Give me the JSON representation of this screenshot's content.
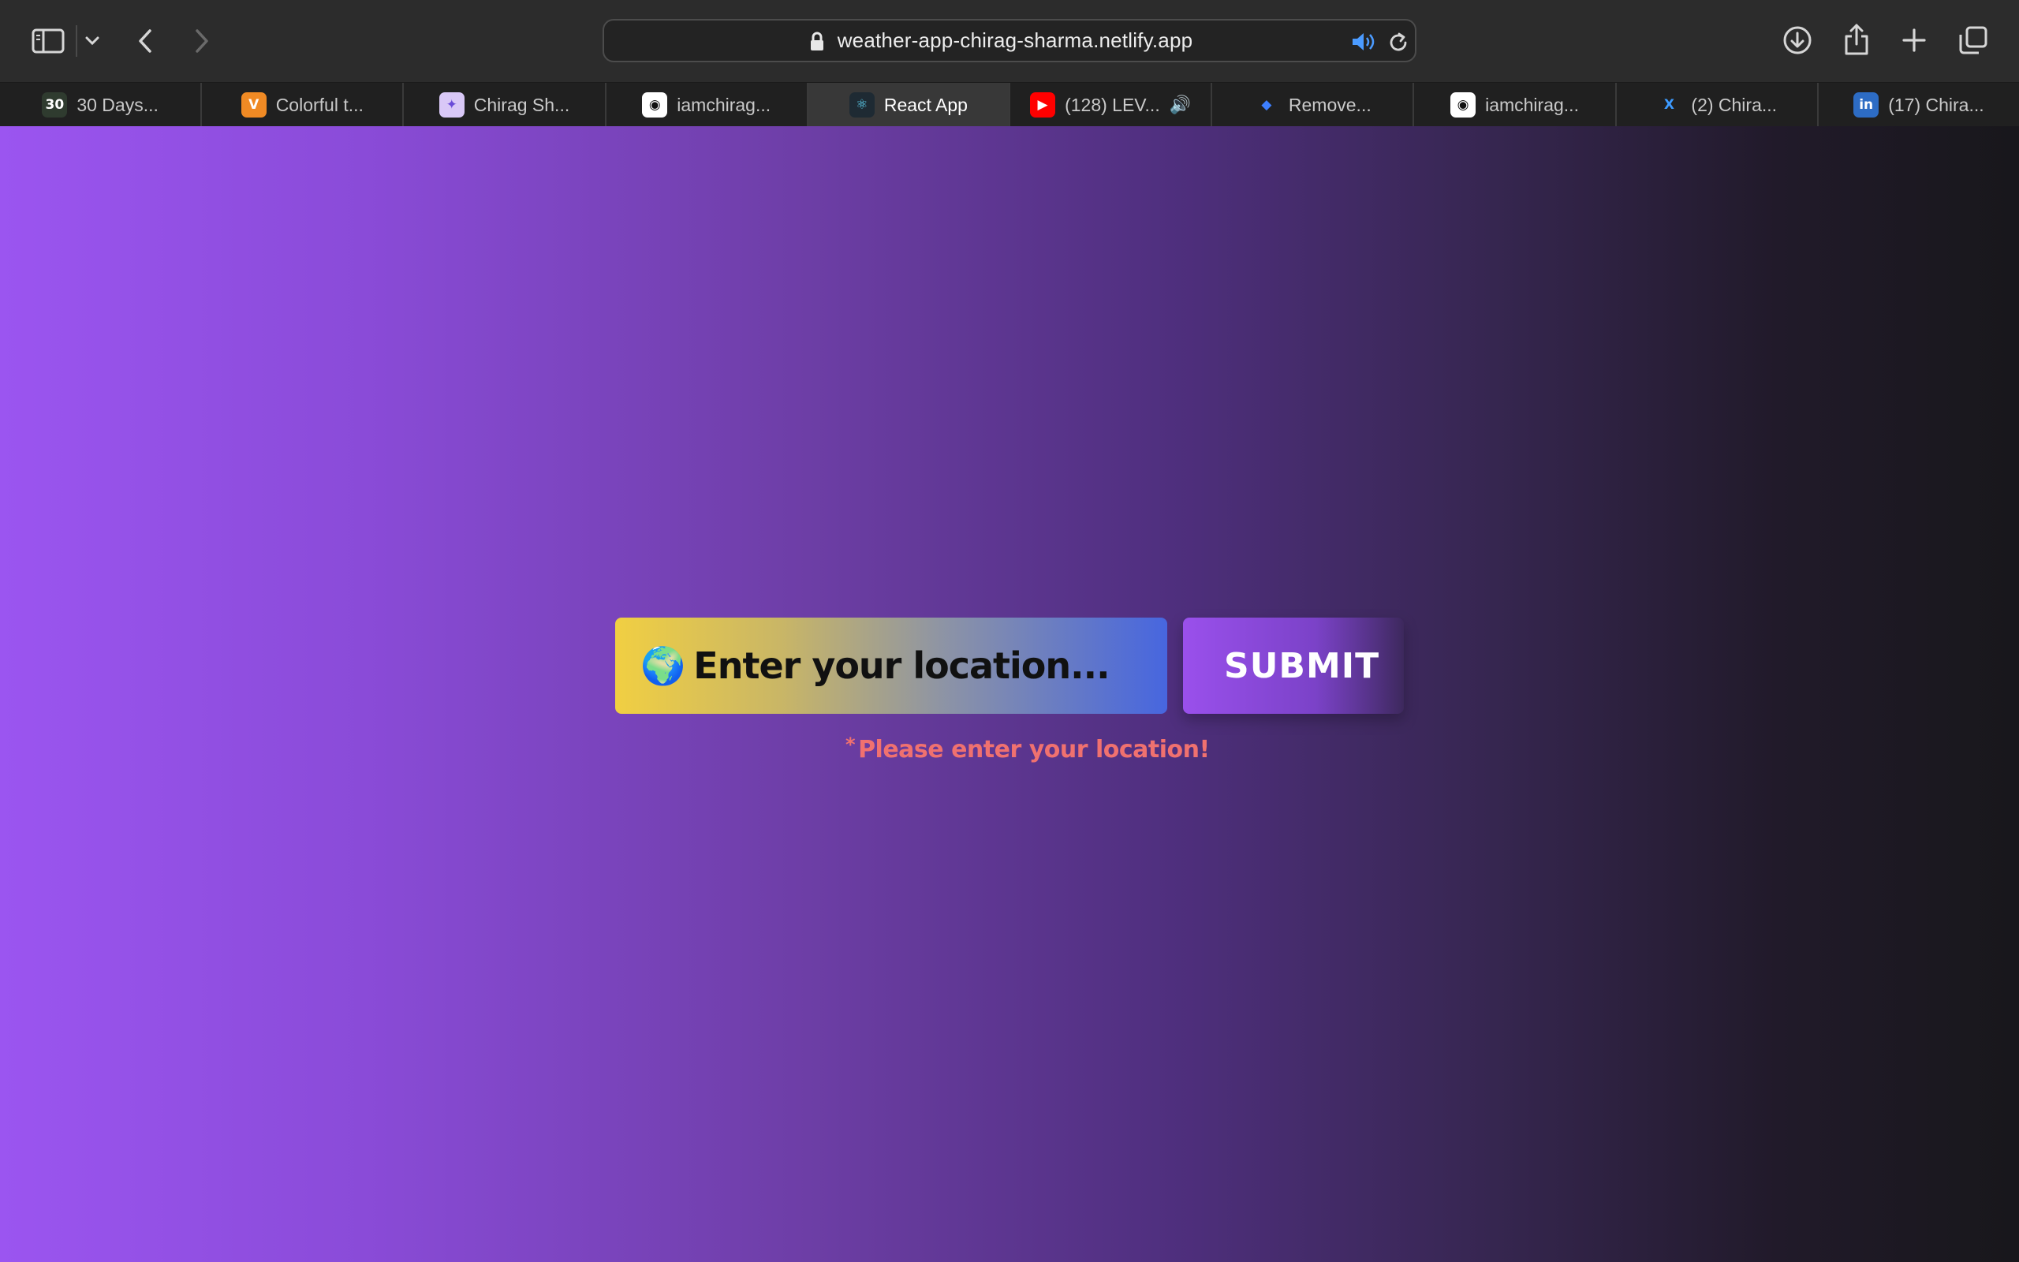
{
  "browser": {
    "url": "weather-app-chirag-sharma.netlify.app",
    "tabs": [
      {
        "label": "30 Days...",
        "favicon": "30",
        "favicon_bg": "#2f3b2f",
        "favicon_color": "#ffffff",
        "icon": "30-days-icon"
      },
      {
        "label": "Colorful t...",
        "favicon": "V",
        "favicon_bg": "#f08a24",
        "favicon_color": "#ffffff",
        "icon": "vite-icon"
      },
      {
        "label": "Chirag Sh...",
        "favicon": "✦",
        "favicon_bg": "#d9c8f7",
        "favicon_color": "#6a4bd8",
        "icon": "portfolio-icon"
      },
      {
        "label": "iamchirag...",
        "favicon": "◉",
        "favicon_bg": "#ffffff",
        "favicon_color": "#111111",
        "icon": "github-icon"
      },
      {
        "label": "React App",
        "favicon": "⚛",
        "favicon_bg": "#1e2a33",
        "favicon_color": "#61dafb",
        "icon": "react-icon",
        "active": true
      },
      {
        "label": "(128) LEV...",
        "favicon": "▶",
        "favicon_bg": "#ff0000",
        "favicon_color": "#ffffff",
        "icon": "youtube-icon",
        "audio": "🔊"
      },
      {
        "label": "Remove...",
        "favicon": "◆",
        "favicon_bg": "transparent",
        "favicon_color": "#3d7fff",
        "icon": "remove-bg-icon"
      },
      {
        "label": "iamchirag...",
        "favicon": "◉",
        "favicon_bg": "#ffffff",
        "favicon_color": "#111111",
        "icon": "github-icon"
      },
      {
        "label": "(2) Chira...",
        "favicon": "X",
        "favicon_bg": "transparent",
        "favicon_color": "#3d9bff",
        "icon": "x-twitter-icon"
      },
      {
        "label": "(17) Chira...",
        "favicon": "in",
        "favicon_bg": "#2d6cc4",
        "favicon_color": "#ffffff",
        "icon": "linkedin-icon"
      }
    ]
  },
  "app": {
    "globe": "🌍",
    "search_placeholder": "Enter your location...",
    "submit_label": "SUBMIT",
    "error_asterisk": "*",
    "error_text": "Please enter your location!"
  }
}
